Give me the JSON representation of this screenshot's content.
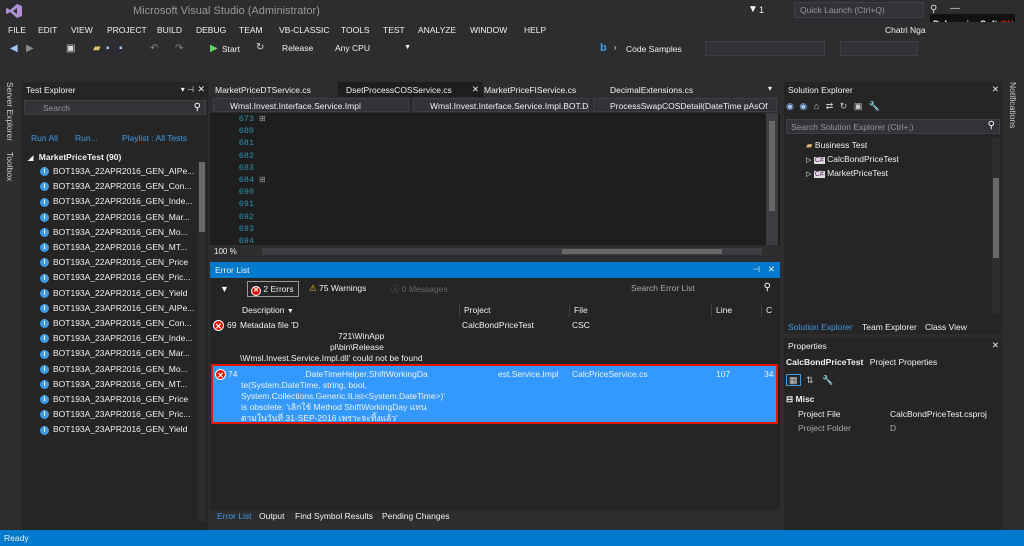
{
  "window": {
    "title": "Microsoft Visual Studio (Administrator)",
    "notifications_count": "1",
    "quick_launch": "Quick Launch (Ctrl+Q)",
    "user": "Chatri Nga",
    "watermark": "DebuggingSoft",
    "watermark_cn": "CN"
  },
  "menu": [
    "FILE",
    "EDIT",
    "VIEW",
    "PROJECT",
    "BUILD",
    "DEBUG",
    "TEAM",
    "VB-CLASSIC",
    "TOOLS",
    "TEST",
    "ANALYZE",
    "WINDOW",
    "HELP"
  ],
  "toolbar": {
    "start": "Start",
    "config": "Release",
    "platform": "Any CPU",
    "code_samples": "Code Samples"
  },
  "left_vtabs": [
    "Server Explorer",
    "Toolbox"
  ],
  "right_vtabs": [
    "Notifications"
  ],
  "test_explorer": {
    "title": "Test Explorer",
    "search_placeholder": "Search",
    "run_all": "Run All",
    "run": "Run...",
    "playlist": "Playlist : All Tests",
    "group": "MarketPriceTest (90)",
    "items": [
      "BOT193A_22APR2016_GEN_AIPe...",
      "BOT193A_22APR2016_GEN_Con...",
      "BOT193A_22APR2016_GEN_Inde...",
      "BOT193A_22APR2016_GEN_Mar...",
      "BOT193A_22APR2016_GEN_Mo...",
      "BOT193A_22APR2016_GEN_MT...",
      "BOT193A_22APR2016_GEN_Price",
      "BOT193A_22APR2016_GEN_Pric...",
      "BOT193A_22APR2016_GEN_Yield",
      "BOT193A_23APR2016_GEN_AIPe...",
      "BOT193A_23APR2016_GEN_Con...",
      "BOT193A_23APR2016_GEN_Inde...",
      "BOT193A_23APR2016_GEN_Mar...",
      "BOT193A_23APR2016_GEN_Mo...",
      "BOT193A_23APR2016_GEN_MT...",
      "BOT193A_23APR2016_GEN_Price",
      "BOT193A_23APR2016_GEN_Pric...",
      "BOT193A_23APR2016_GEN_Yield"
    ]
  },
  "editor": {
    "tabs": [
      "MarketPriceDTService.cs",
      "DsetProcessCOSService.cs",
      "MarketPriceFIService.cs",
      "DecimalExtensions.cs"
    ],
    "nav": [
      "Wmsl.Invest.Interface.Service.Impl",
      "Wmsl.Invest.Interface.Service.Impl.BOT.D",
      "ProcessSwapCOSDetail(DateTime pAsOf"
    ],
    "line_numbers": [
      "673",
      "680",
      "681",
      "682",
      "683",
      "684",
      "690",
      "691",
      "692",
      "693",
      "694"
    ],
    "zoom": "100 %"
  },
  "error_list": {
    "title": "Error List",
    "errors_btn": "2 Errors",
    "warnings_btn": "75 Warnings",
    "messages_btn": "0 Messages",
    "search_placeholder": "Search Error List",
    "columns": [
      "Description",
      "Project",
      "File",
      "Line",
      "C"
    ],
    "rows": [
      {
        "num": "69",
        "desc": [
          "Metadata file 'D",
          "721\\WinApp",
          "pl\\bin\\Release",
          "\\Wmsl.Invest.Service.Impl.dll' could not be found"
        ],
        "project": "CalcBondPriceTest",
        "file": "CSC",
        "line": "",
        "col": ""
      },
      {
        "num": "74",
        ".desc_note": "",
        "desc": [
          ".DateTimeHelper.ShiftWorkingDa",
          "te(System.DateTime, string, bool,",
          "System.Collections.Generic.IList<System.DateTime>)'",
          "is obsolete: 'เลิกใช้ Method ShiftWorkingDay แทน",
          "ตามในวันที่ 31-SEP-2016 เพราะจะทิ้งแล้ว'"
        ],
        "project": "est.Service.Impl",
        "file": "CalcPriceService.cs",
        "line": "107",
        "col": "34"
      }
    ],
    "bottom_tabs": [
      "Error List",
      "Output",
      "Find Symbol Results",
      "Pending Changes"
    ]
  },
  "solution_explorer": {
    "title": "Solution Explorer",
    "search_placeholder": "Search Solution Explorer (Ctrl+;)",
    "items": [
      "Business Test",
      "CalcBondPriceTest",
      "MarketPriceTest"
    ],
    "tabs": [
      "Solution Explorer",
      "Team Explorer",
      "Class View"
    ]
  },
  "properties": {
    "title": "Properties",
    "object": "CalcBondPriceTest",
    "object_type": "Project Properties",
    "category": "Misc",
    "rows": [
      {
        "name": "Project File",
        "value": "CalcBondPriceTest.csproj"
      },
      {
        "name": "Project Folder",
        "value": "D"
      }
    ]
  },
  "status": {
    "text": "Ready"
  },
  "colors": {
    "accent": "#007acc",
    "highlight_row": "#3399ff",
    "error_border": "#e51400"
  }
}
